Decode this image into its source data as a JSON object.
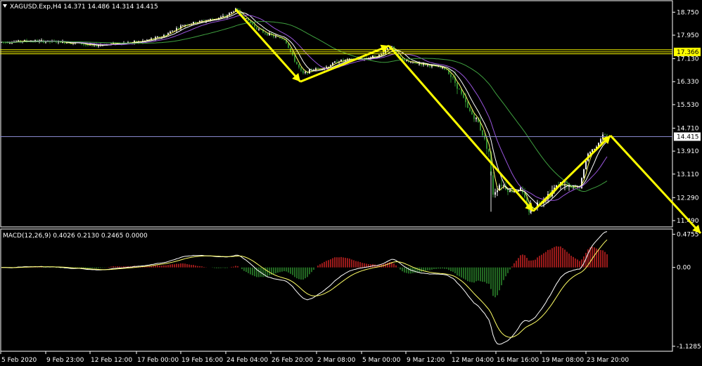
{
  "main_panel": {
    "symbol_info": "XAGUSD.Exp,H4  14.371 14.486 14.314 14.415",
    "symbol_icon": "triangle-down-icon"
  },
  "macd_panel": {
    "label": "MACD(12,26,9) 0.4026 0.2130 0.2465 0.0000"
  },
  "colors": {
    "background": "#000000",
    "axis": "#ffffff",
    "bull_candle": "#e8e8e8",
    "bear_candle": "#2d8a2d",
    "ma_fast": "#ffff66",
    "ma_white": "#ffffff",
    "ma_purple": "#9955dd",
    "ma_green": "#3fa03f",
    "level_lines": "#ffff00",
    "current_price_line": "#8888cc",
    "arrows": "#ffff00",
    "hist_up": "#cc2222",
    "hist_down": "#2d8a2d"
  },
  "chart_data": [
    {
      "type": "candlestick",
      "title": "XAGUSD.Exp,H4",
      "ohlc_last": {
        "open": 14.371,
        "high": 14.486,
        "low": 14.314,
        "close": 14.415
      },
      "y_ticks": [
        "18.750",
        "17.950",
        "17.130",
        "16.330",
        "15.530",
        "14.710",
        "13.910",
        "13.110",
        "12.290",
        "11.490"
      ],
      "x_ticks": [
        "5 Feb 2020",
        "9 Feb 23:00",
        "12 Feb 12:00",
        "17 Feb 00:00",
        "19 Feb 16:00",
        "24 Feb 04:00",
        "26 Feb 20:00",
        "2 Mar 08:00",
        "5 Mar 00:00",
        "9 Mar 12:00",
        "12 Mar 04:00",
        "16 Mar 16:00",
        "19 Mar 08:00",
        "23 Mar 20:00"
      ],
      "ylim": [
        11.27,
        19.15
      ],
      "price_labels": [
        "17.366",
        "14.415"
      ],
      "horizontal_levels": [
        17.366,
        17.44,
        17.3
      ],
      "current_price": 14.415,
      "close_path": [
        {
          "t": 0,
          "p": 17.7
        },
        {
          "t": 40,
          "p": 17.75
        },
        {
          "t": 80,
          "p": 17.72
        },
        {
          "t": 110,
          "p": 17.68
        },
        {
          "t": 130,
          "p": 17.58
        },
        {
          "t": 160,
          "p": 17.65
        },
        {
          "t": 200,
          "p": 17.72
        },
        {
          "t": 230,
          "p": 17.9
        },
        {
          "t": 260,
          "p": 18.3
        },
        {
          "t": 290,
          "p": 18.45
        },
        {
          "t": 320,
          "p": 18.6
        },
        {
          "t": 335,
          "p": 18.85
        },
        {
          "t": 350,
          "p": 18.5
        },
        {
          "t": 370,
          "p": 18.1
        },
        {
          "t": 390,
          "p": 17.9
        },
        {
          "t": 405,
          "p": 17.8
        },
        {
          "t": 418,
          "p": 17.1
        },
        {
          "t": 430,
          "p": 16.6
        },
        {
          "t": 445,
          "p": 16.75
        },
        {
          "t": 465,
          "p": 16.85
        },
        {
          "t": 480,
          "p": 17.05
        },
        {
          "t": 500,
          "p": 17.1
        },
        {
          "t": 520,
          "p": 17.15
        },
        {
          "t": 540,
          "p": 17.25
        },
        {
          "t": 555,
          "p": 17.6
        },
        {
          "t": 565,
          "p": 17.2
        },
        {
          "t": 580,
          "p": 17.0
        },
        {
          "t": 600,
          "p": 16.95
        },
        {
          "t": 620,
          "p": 16.85
        },
        {
          "t": 635,
          "p": 16.75
        },
        {
          "t": 650,
          "p": 16.2
        },
        {
          "t": 665,
          "p": 15.4
        },
        {
          "t": 680,
          "p": 14.9
        },
        {
          "t": 695,
          "p": 13.9
        },
        {
          "t": 700,
          "p": 12.4
        },
        {
          "t": 712,
          "p": 12.8
        },
        {
          "t": 725,
          "p": 12.5
        },
        {
          "t": 740,
          "p": 12.6
        },
        {
          "t": 752,
          "p": 11.85
        },
        {
          "t": 765,
          "p": 12.1
        },
        {
          "t": 780,
          "p": 12.4
        },
        {
          "t": 795,
          "p": 12.8
        },
        {
          "t": 810,
          "p": 12.6
        },
        {
          "t": 825,
          "p": 12.7
        },
        {
          "t": 835,
          "p": 13.8
        },
        {
          "t": 848,
          "p": 14.1
        },
        {
          "t": 858,
          "p": 14.5
        },
        {
          "t": 865,
          "p": 14.415
        }
      ],
      "arrows": [
        {
          "from": {
            "t": 335,
            "p": 18.85
          },
          "to": {
            "t": 427,
            "p": 16.33
          }
        },
        {
          "from": {
            "t": 427,
            "p": 16.33
          },
          "to": {
            "t": 553,
            "p": 17.58
          }
        },
        {
          "from": {
            "t": 553,
            "p": 17.58
          },
          "to": {
            "t": 758,
            "p": 11.82
          }
        },
        {
          "from": {
            "t": 758,
            "p": 11.82
          },
          "to": {
            "t": 868,
            "p": 14.45
          }
        },
        {
          "from": {
            "t": 868,
            "p": 14.45
          },
          "to": {
            "t": 996,
            "p": 11.05
          }
        }
      ]
    },
    {
      "type": "macd",
      "title": "MACD(12,26,9)",
      "values": {
        "macd": 0.4026,
        "signal": 0.213,
        "histogram": 0.2465,
        "zero": 0.0
      },
      "y_ticks": [
        "0.4755",
        "0.00",
        "-1.1285"
      ],
      "ylim": [
        -1.2,
        0.55
      ]
    }
  ]
}
